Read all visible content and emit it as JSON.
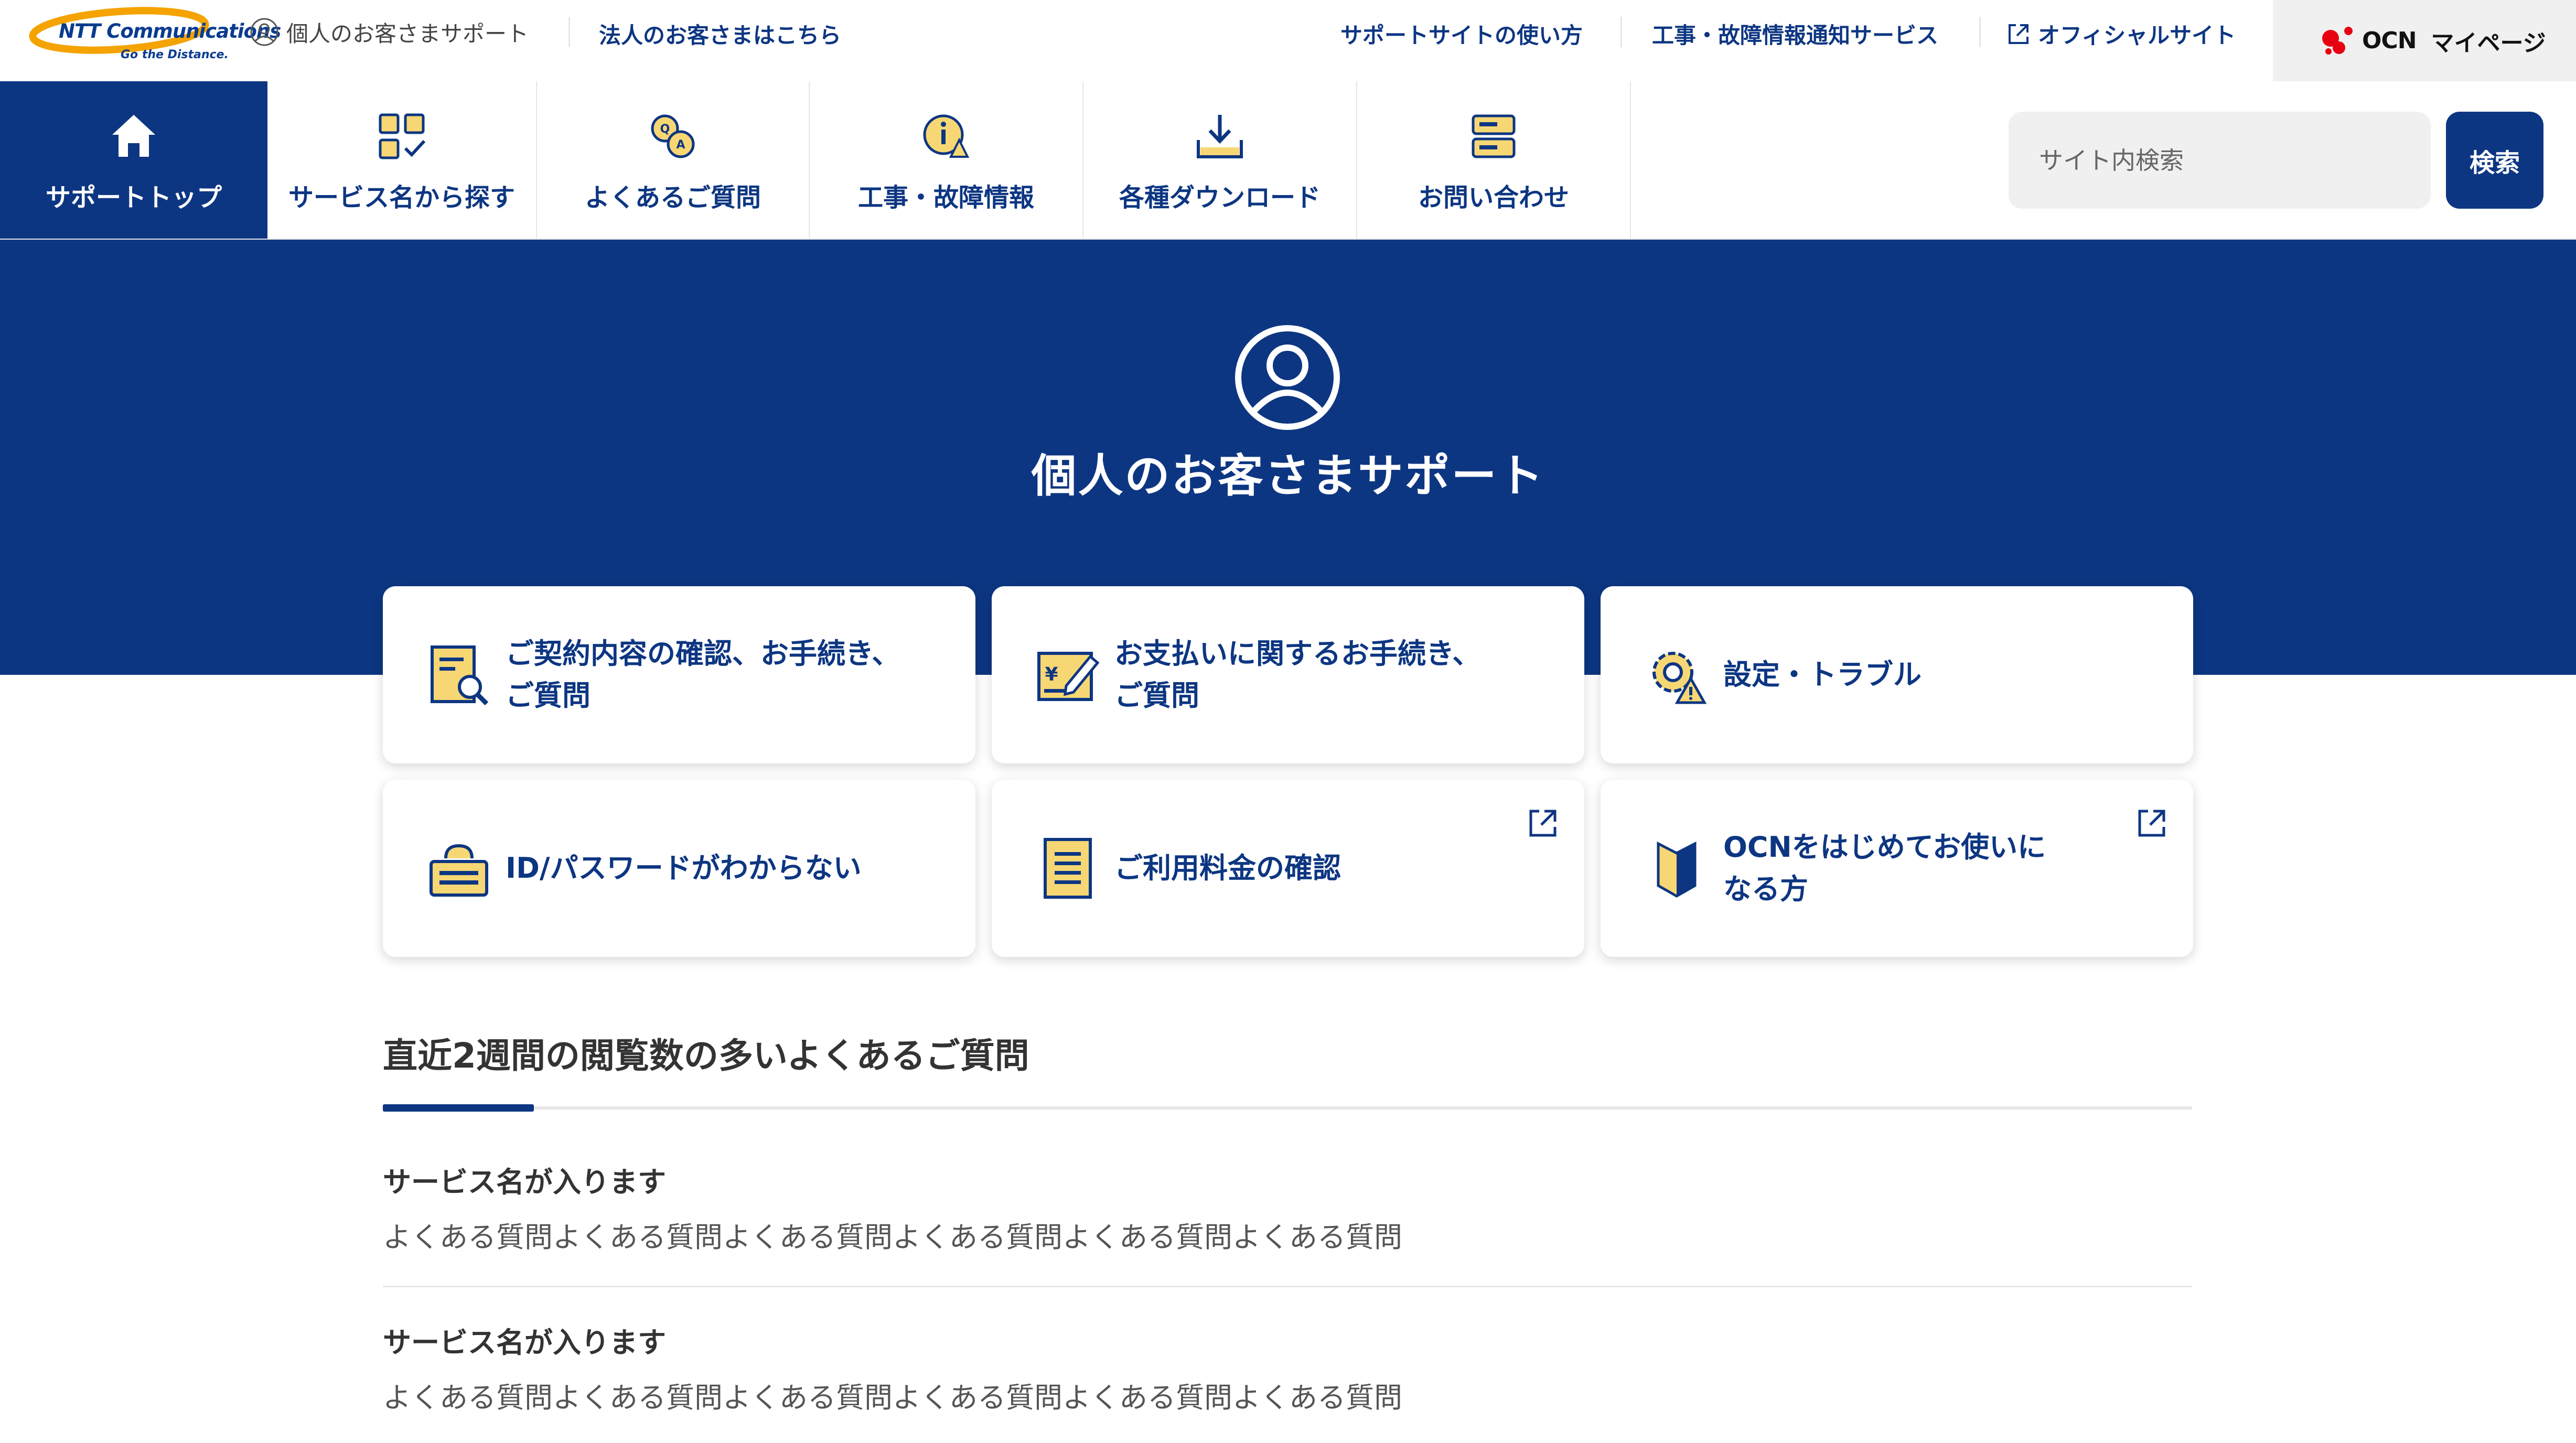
{
  "header": {
    "logo": {
      "brand": "NTT Communications",
      "tagline": "Go the Distance."
    },
    "personal_support": "個人のお客さまサポート",
    "corporate_link": "法人のお客さまはこちら",
    "links": [
      "サポートサイトの使い方",
      "工事・故障情報通知サービス"
    ],
    "official_site": "オフィシャルサイト",
    "mypage": {
      "logo_text": "OCN",
      "label": "マイページ"
    }
  },
  "nav": {
    "items": [
      {
        "label": "サポートトップ",
        "icon": "home-icon",
        "active": true
      },
      {
        "label": "サービス名から探す",
        "icon": "grid-check-icon"
      },
      {
        "label": "よくあるご質問",
        "icon": "qa-icon"
      },
      {
        "label": "工事・故障情報",
        "icon": "construction-info-icon"
      },
      {
        "label": "各種ダウンロード",
        "icon": "download-icon"
      },
      {
        "label": "お問い合わせ",
        "icon": "contact-icon"
      }
    ],
    "search": {
      "placeholder": "サイト内検索",
      "button": "検索"
    }
  },
  "hero": {
    "title": "個人のお客さまサポート",
    "icon": "user-circle-icon"
  },
  "cards": [
    {
      "line1": "ご契約内容の確認、お手続き、",
      "line2": "ご質問",
      "icon": "contract-search-icon",
      "external": false
    },
    {
      "line1": "お支払いに関するお手続き、",
      "line2": "ご質問",
      "icon": "payment-edit-icon",
      "external": false
    },
    {
      "line1": "設定・トラブル",
      "line2": "",
      "icon": "gear-warning-icon",
      "external": false
    },
    {
      "line1": "ID/パスワードがわからない",
      "line2": "",
      "icon": "id-password-icon",
      "external": false
    },
    {
      "line1": "ご利用料金の確認",
      "line2": "",
      "icon": "bill-icon",
      "external": true
    },
    {
      "line1": "OCNをはじめてお使いに",
      "line2": "なる方",
      "icon": "beginner-mark-icon",
      "external": true
    }
  ],
  "faq": {
    "heading": "直近2週間の閲覧数の多いよくあるご質問",
    "items": [
      {
        "service": "サービス名が入ります",
        "question": "よくある質問よくある質問よくある質問よくある質問よくある質問よくある質問"
      },
      {
        "service": "サービス名が入ります",
        "question": "よくある質問よくある質問よくある質問よくある質問よくある質問よくある質問"
      }
    ]
  },
  "colors": {
    "primary": "#0d3682",
    "accent_yellow": "#f7d774",
    "panel_gray": "#f0f0f0",
    "ocn_red": "#e60012"
  }
}
